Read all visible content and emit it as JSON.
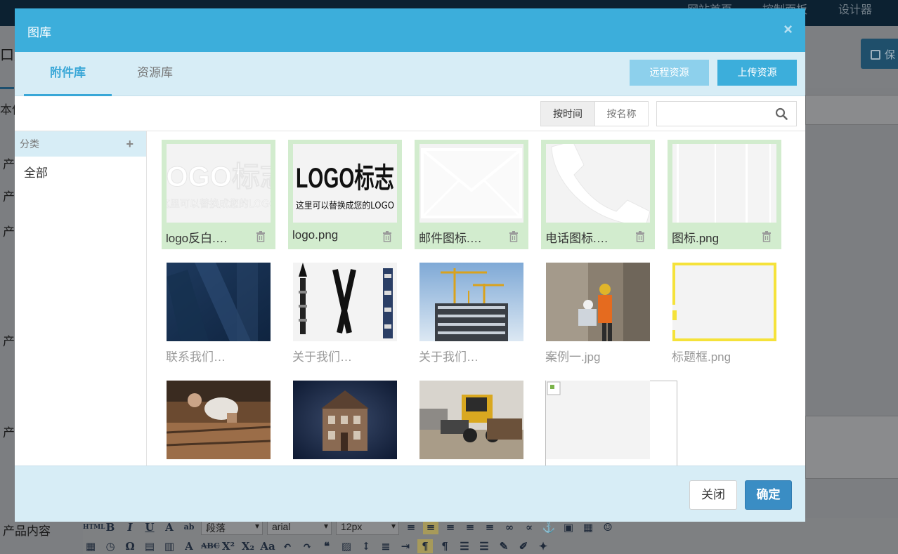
{
  "background": {
    "nav": [
      "网站首页",
      "控制面板",
      "设计器"
    ],
    "save_label": "保",
    "labels": [
      "口产",
      "本信",
      "产",
      "产",
      "产",
      "产",
      "产",
      "产品内容"
    ],
    "editor": {
      "paragraph": "段落",
      "font": "arial",
      "size": "12px"
    }
  },
  "modal": {
    "title": "图库",
    "close_symbol": "×",
    "tabs": [
      {
        "label": "附件库",
        "active": true
      },
      {
        "label": "资源库",
        "active": false
      }
    ],
    "buttons": {
      "remote": "远程资源",
      "upload": "上传资源",
      "close": "关闭",
      "ok": "确定"
    },
    "sort": {
      "by_time": "按时间",
      "by_name": "按名称"
    },
    "search": {
      "value": "",
      "placeholder": ""
    },
    "sidebar": {
      "heading": "分类",
      "add_symbol": "+",
      "items": [
        "全部"
      ]
    },
    "images": [
      {
        "name": "logo反白.…",
        "selected": true,
        "thumb": "logo-white"
      },
      {
        "name": "logo.png",
        "selected": true,
        "thumb": "logo-black"
      },
      {
        "name": "邮件图标.…",
        "selected": true,
        "thumb": "mail"
      },
      {
        "name": "电话图标.…",
        "selected": true,
        "thumb": "phone"
      },
      {
        "name": "图标.png",
        "selected": true,
        "thumb": "icons"
      },
      {
        "name": "联系我们…",
        "selected": false,
        "thumb": "blue-building"
      },
      {
        "name": "关于我们…",
        "selected": false,
        "thumb": "tools"
      },
      {
        "name": "关于我们…",
        "selected": false,
        "thumb": "construction"
      },
      {
        "name": "案例一.jpg",
        "selected": false,
        "thumb": "workers"
      },
      {
        "name": "标题框.png",
        "selected": false,
        "thumb": "title-frame"
      },
      {
        "name": "",
        "selected": false,
        "thumb": "carpenter"
      },
      {
        "name": "",
        "selected": false,
        "thumb": "house"
      },
      {
        "name": "",
        "selected": false,
        "thumb": "bulldozer"
      },
      {
        "name": "",
        "selected": false,
        "thumb": "broken"
      }
    ],
    "colors": {
      "header": "#3caedb",
      "tabbar": "#d7edf6",
      "selected_card": "#d2ecce",
      "ok_button": "#3a8dc4"
    }
  }
}
